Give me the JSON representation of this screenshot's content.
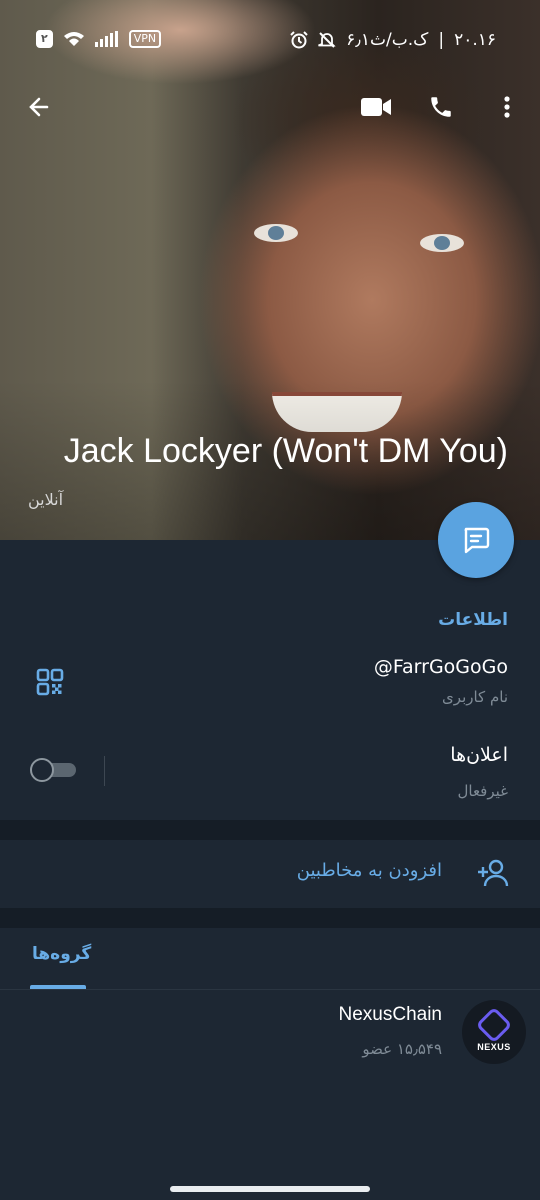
{
  "status_bar": {
    "time": "۲۰.۱۶",
    "speed": "۶٫۱ک.ب/ث",
    "separator": "|",
    "vpn": "VPN",
    "sim_badge": "۲"
  },
  "profile": {
    "name": "Jack Lockyer (Won't DM You)",
    "status": "آنلاین"
  },
  "info": {
    "section_title": "اطلاعات",
    "username": "@FarrGoGoGo",
    "username_label": "نام کاربری",
    "notifications_title": "اعلان‌ها",
    "notifications_value": "غیرفعال"
  },
  "actions": {
    "add_contact": "افزودن به مخاطبین"
  },
  "tabs": {
    "groups": "گروه‌ها"
  },
  "groups": [
    {
      "name": "NexusChain",
      "members": "۱۵٫۵۴۹ عضو",
      "avatar_text": "NEXUS"
    }
  ],
  "colors": {
    "accent": "#68ace6",
    "fab": "#5aa3e0",
    "background": "#1d2733",
    "separator": "#151d26"
  }
}
